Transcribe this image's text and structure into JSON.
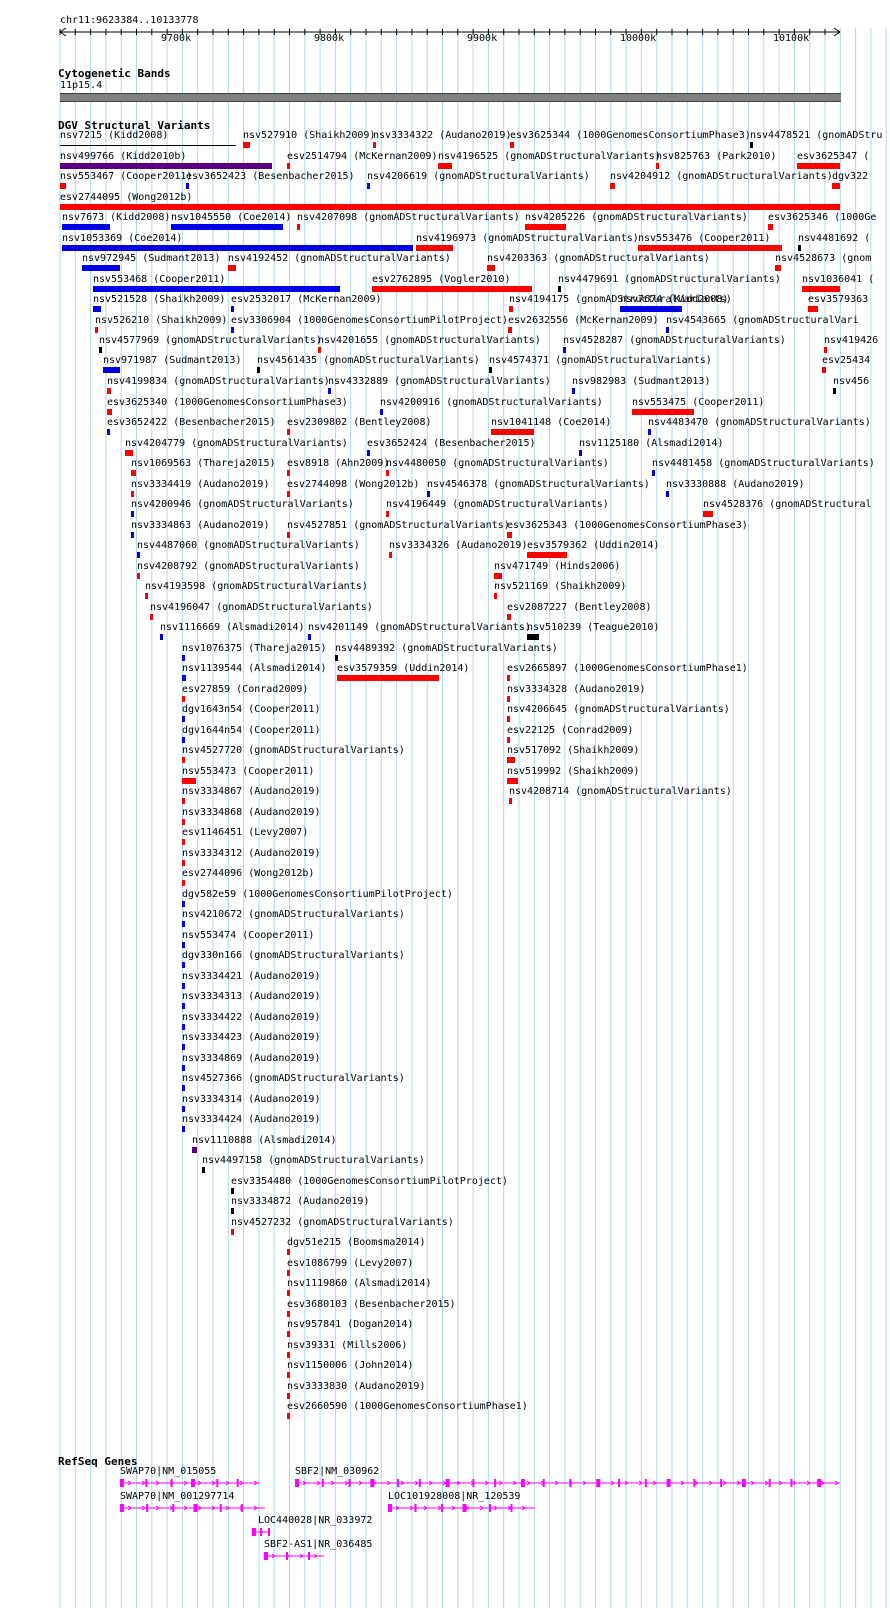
{
  "header": {
    "location": "chr11:9623384..10133778",
    "ticks": [
      "9700k",
      "9800k",
      "9900k",
      "10000k",
      "10100k"
    ]
  },
  "tracks": {
    "cytoband_title": "Cytogenetic Bands",
    "cytoband_name": "11p15.4",
    "dgv_title": "DGV Structural Variants",
    "refseq_title": "RefSeq Genes"
  },
  "colors": {
    "loss": "#ff0000",
    "gain": "#0000e6",
    "gain_loss": "#5a0080",
    "novel": "#000000",
    "gene": "#ff00ff",
    "grid": "#add8f0"
  },
  "features": [
    {
      "label": "nsv7215 (Kidd2008)",
      "type": "novel"
    },
    {
      "label": "nsv527910 (Shaikh2009)",
      "type": "loss"
    },
    {
      "label": "nsv3334322 (Audano2019)",
      "type": "loss"
    },
    {
      "label": "esv3625344 (1000GenomesConsortiumPhase3)",
      "type": "loss"
    },
    {
      "label": "nsv4478521 (gnomADStru",
      "type": "novel"
    },
    {
      "label": "nsv499766 (Kidd2010b)",
      "type": "gain_loss"
    },
    {
      "label": "esv2514794 (McKernan2009)",
      "type": "loss"
    },
    {
      "label": "nsv4196525 (gnomADStructuralVariants)",
      "type": "loss"
    },
    {
      "label": "nsv825763 (Park2010)",
      "type": "loss"
    },
    {
      "label": "esv3625347 (",
      "type": "loss"
    },
    {
      "label": "nsv553467 (Cooper2011)",
      "type": "loss"
    },
    {
      "label": "esv3652423 (Besenbacher2015)",
      "type": "gain"
    },
    {
      "label": "nsv4206619 (gnomADStructuralVariants)",
      "type": "gain"
    },
    {
      "label": "nsv4204912 (gnomADStructuralVariants)",
      "type": "loss"
    },
    {
      "label": "dgv322",
      "type": "loss"
    },
    {
      "label": "esv2744095 (Wong2012b)",
      "type": "loss"
    },
    {
      "label": "nsv7673 (Kidd2008)",
      "type": "gain"
    },
    {
      "label": "nsv1045550 (Coe2014)",
      "type": "gain"
    },
    {
      "label": "nsv4207098 (gnomADStructuralVariants)",
      "type": "loss"
    },
    {
      "label": "nsv4205226 (gnomADStructuralVariants)",
      "type": "loss"
    },
    {
      "label": "esv3625346 (1000Ge",
      "type": "loss"
    },
    {
      "label": "nsv1053369 (Coe2014)",
      "type": "gain"
    },
    {
      "label": "nsv4196973 (gnomADStructuralVariants)",
      "type": "loss"
    },
    {
      "label": "nsv553476 (Cooper2011)",
      "type": "loss"
    },
    {
      "label": "nsv4481692 (",
      "type": "novel"
    },
    {
      "label": "nsv972945 (Sudmant2013)",
      "type": "gain"
    },
    {
      "label": "nsv4192452 (gnomADStructuralVariants)",
      "type": "loss"
    },
    {
      "label": "nsv4203363 (gnomADStructuralVariants)",
      "type": "loss"
    },
    {
      "label": "nsv4528673 (gnom",
      "type": "loss"
    },
    {
      "label": "nsv553468 (Cooper2011)",
      "type": "gain"
    },
    {
      "label": "esv2762895 (Vogler2010)",
      "type": "loss"
    },
    {
      "label": "nsv4479691 (gnomADStructuralVariants)",
      "type": "novel"
    },
    {
      "label": "nsv1036041 (",
      "type": "loss"
    },
    {
      "label": "nsv521528 (Shaikh2009)",
      "type": "gain"
    },
    {
      "label": "esv2532017 (McKernan2009)",
      "type": "gain"
    },
    {
      "label": "nsv4194175 (gnomADStructuralVariants)",
      "type": "loss"
    },
    {
      "label": "nsv7674 (Kidd2008)",
      "type": "gain"
    },
    {
      "label": "esv3579363",
      "type": "loss"
    },
    {
      "label": "nsv526210 (Shaikh2009)",
      "type": "loss"
    },
    {
      "label": "esv3306904 (1000GenomesConsortiumPilotProject)",
      "type": "gain"
    },
    {
      "label": "esv2632556 (McKernan2009)",
      "type": "loss"
    },
    {
      "label": "nsv4543665 (gnomADStructuralVari",
      "type": "gain"
    },
    {
      "label": "nsv4577969 (gnomADStructuralVariants)",
      "type": "novel"
    },
    {
      "label": "nsv4201655 (gnomADStructuralVariants)",
      "type": "loss"
    },
    {
      "label": "nsv4528287 (gnomADStructuralVariants)",
      "type": "gain"
    },
    {
      "label": "nsv419426",
      "type": "loss"
    },
    {
      "label": "nsv971987 (Sudmant2013)",
      "type": "gain"
    },
    {
      "label": "nsv4561435 (gnomADStructuralVariants)",
      "type": "novel"
    },
    {
      "label": "nsv4574371 (gnomADStructuralVariants)",
      "type": "novel"
    },
    {
      "label": "esv25434",
      "type": "loss"
    },
    {
      "label": "nsv4199834 (gnomADStructuralVariants)",
      "type": "loss"
    },
    {
      "label": "nsv4332889 (gnomADStructuralVariants)",
      "type": "gain"
    },
    {
      "label": "nsv982983 (Sudmant2013)",
      "type": "gain"
    },
    {
      "label": "nsv456",
      "type": "novel"
    },
    {
      "label": "esv3625340 (1000GenomesConsortiumPhase3)",
      "type": "loss"
    },
    {
      "label": "nsv4200916 (gnomADStructuralVariants)",
      "type": "gain"
    },
    {
      "label": "nsv553475 (Cooper2011)",
      "type": "loss"
    },
    {
      "label": "esv3652422 (Besenbacher2015)",
      "type": "gain"
    },
    {
      "label": "esv2309802 (Bentley2008)",
      "type": "loss"
    },
    {
      "label": "nsv1041148 (Coe2014)",
      "type": "loss"
    },
    {
      "label": "nsv4483470 (gnomADStructuralVariants)",
      "type": "gain"
    },
    {
      "label": "nsv4204779 (gnomADStructuralVariants)",
      "type": "loss"
    },
    {
      "label": "esv3652424 (Besenbacher2015)",
      "type": "gain"
    },
    {
      "label": "nsv1125180 (Alsmadi2014)",
      "type": "gain"
    },
    {
      "label": "nsv1069563 (Thareja2015)",
      "type": "loss"
    },
    {
      "label": "esv8918 (Ahn2009)",
      "type": "loss"
    },
    {
      "label": "nsv4480050 (gnomADStructuralVariants)",
      "type": "loss"
    },
    {
      "label": "nsv4481458 (gnomADStructuralVariants)",
      "type": "gain"
    },
    {
      "label": "nsv3334419 (Audano2019)",
      "type": "loss"
    },
    {
      "label": "esv2744098 (Wong2012b)",
      "type": "loss"
    },
    {
      "label": "nsv4546378 (gnomADStructuralVariants)",
      "type": "gain"
    },
    {
      "label": "nsv3330888 (Audano2019)",
      "type": "gain"
    },
    {
      "label": "nsv4200946 (gnomADStructuralVariants)",
      "type": "gain"
    },
    {
      "label": "nsv4196449 (gnomADStructuralVariants)",
      "type": "loss"
    },
    {
      "label": "nsv4528376 (gnomADStructural",
      "type": "loss"
    },
    {
      "label": "nsv3334863 (Audano2019)",
      "type": "gain"
    },
    {
      "label": "nsv4527851 (gnomADStructuralVariants)",
      "type": "loss"
    },
    {
      "label": "esv3625343 (1000GenomesConsortiumPhase3)",
      "type": "loss"
    },
    {
      "label": "nsv4487060 (gnomADStructuralVariants)",
      "type": "gain"
    },
    {
      "label": "nsv3334326 (Audano2019)",
      "type": "loss"
    },
    {
      "label": "esv3579362 (Uddin2014)",
      "type": "loss"
    },
    {
      "label": "nsv4208792 (gnomADStructuralVariants)",
      "type": "loss"
    },
    {
      "label": "nsv471749 (Hinds2006)",
      "type": "loss"
    },
    {
      "label": "nsv4193598 (gnomADStructuralVariants)",
      "type": "loss"
    },
    {
      "label": "nsv521169 (Shaikh2009)",
      "type": "loss"
    },
    {
      "label": "nsv4196047 (gnomADStructuralVariants)",
      "type": "loss"
    },
    {
      "label": "esv2087227 (Bentley2008)",
      "type": "loss"
    },
    {
      "label": "nsv1116669 (Alsmadi2014)",
      "type": "gain"
    },
    {
      "label": "nsv4201149 (gnomADStructuralVariants)",
      "type": "gain"
    },
    {
      "label": "nsv510239 (Teague2010)",
      "type": "novel"
    },
    {
      "label": "nsv1076375 (Thareja2015)",
      "type": "gain"
    },
    {
      "label": "nsv4489392 (gnomADStructuralVariants)",
      "type": "novel"
    },
    {
      "label": "nsv1139544 (Alsmadi2014)",
      "type": "gain"
    },
    {
      "label": "esv3579359 (Uddin2014)",
      "type": "loss"
    },
    {
      "label": "esv2665897 (1000GenomesConsortiumPhase1)",
      "type": "loss"
    },
    {
      "label": "esv27859 (Conrad2009)",
      "type": "loss"
    },
    {
      "label": "nsv3334328 (Audano2019)",
      "type": "loss"
    },
    {
      "label": "dgv1643n54 (Cooper2011)",
      "type": "gain"
    },
    {
      "label": "nsv4206645 (gnomADStructuralVariants)",
      "type": "loss"
    },
    {
      "label": "dgv1644n54 (Cooper2011)",
      "type": "gain"
    },
    {
      "label": "esv22125 (Conrad2009)",
      "type": "loss"
    },
    {
      "label": "nsv4527720 (gnomADStructuralVariants)",
      "type": "loss"
    },
    {
      "label": "nsv517092 (Shaikh2009)",
      "type": "loss"
    },
    {
      "label": "nsv553473 (Cooper2011)",
      "type": "loss"
    },
    {
      "label": "nsv519992 (Shaikh2009)",
      "type": "loss"
    },
    {
      "label": "nsv3334867 (Audano2019)",
      "type": "loss"
    },
    {
      "label": "nsv4208714 (gnomADStructuralVariants)",
      "type": "loss"
    },
    {
      "label": "nsv3334868 (Audano2019)",
      "type": "loss"
    },
    {
      "label": "esv1146451 (Levy2007)",
      "type": "loss"
    },
    {
      "label": "nsv3334312 (Audano2019)",
      "type": "loss"
    },
    {
      "label": "esv2744096 (Wong2012b)",
      "type": "loss"
    },
    {
      "label": "dgv582e59 (1000GenomesConsortiumPilotProject)",
      "type": "gain"
    },
    {
      "label": "nsv4210672 (gnomADStructuralVariants)",
      "type": "gain"
    },
    {
      "label": "nsv553474 (Cooper2011)",
      "type": "gain"
    },
    {
      "label": "dgv330n166 (gnomADStructuralVariants)",
      "type": "gain"
    },
    {
      "label": "nsv3334421 (Audano2019)",
      "type": "gain"
    },
    {
      "label": "nsv3334313 (Audano2019)",
      "type": "gain"
    },
    {
      "label": "nsv3334422 (Audano2019)",
      "type": "gain"
    },
    {
      "label": "nsv3334423 (Audano2019)",
      "type": "gain"
    },
    {
      "label": "nsv3334869 (Audano2019)",
      "type": "gain"
    },
    {
      "label": "nsv4527366 (gnomADStructuralVariants)",
      "type": "gain"
    },
    {
      "label": "nsv3334314 (Audano2019)",
      "type": "gain"
    },
    {
      "label": "nsv3334424 (Audano2019)",
      "type": "gain"
    },
    {
      "label": "nsv1110888 (Alsmadi2014)",
      "type": "gain_loss"
    },
    {
      "label": "nsv4497158 (gnomADStructuralVariants)",
      "type": "novel"
    },
    {
      "label": "esv3354480 (1000GenomesConsortiumPilotProject)",
      "type": "novel"
    },
    {
      "label": "nsv3334872 (Audano2019)",
      "type": "novel"
    },
    {
      "label": "nsv4527232 (gnomADStructuralVariants)",
      "type": "loss"
    },
    {
      "label": "dgv51e215 (Boomsma2014)",
      "type": "loss"
    },
    {
      "label": "esv1086799 (Levy2007)",
      "type": "loss"
    },
    {
      "label": "nsv1119860 (Alsmadi2014)",
      "type": "loss"
    },
    {
      "label": "esv3680103 (Besenbacher2015)",
      "type": "loss"
    },
    {
      "label": "nsv957841 (Dogan2014)",
      "type": "loss"
    },
    {
      "label": "nsv39331 (Mills2006)",
      "type": "loss"
    },
    {
      "label": "nsv1150006 (John2014)",
      "type": "loss"
    },
    {
      "label": "nsv3333830 (Audano2019)",
      "type": "loss"
    },
    {
      "label": "esv2660590 (1000GenomesConsortiumPhase1)",
      "type": "loss"
    }
  ],
  "genes": [
    {
      "label": "SWAP70|NM_015055"
    },
    {
      "label": "SBF2|NM_030962"
    },
    {
      "label": "SWAP70|NM_001297714"
    },
    {
      "label": "LOC101928008|NR_120539"
    },
    {
      "label": "LOC440028|NR_033972"
    },
    {
      "label": "SBF2-AS1|NR_036485"
    }
  ]
}
